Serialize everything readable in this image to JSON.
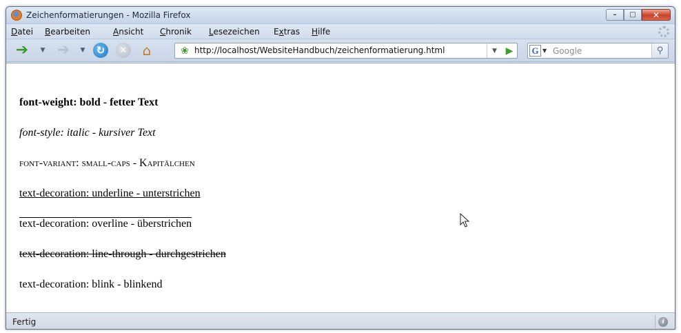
{
  "window": {
    "title": "Zeichenformatierungen - Mozilla Firefox"
  },
  "menubar": {
    "items": [
      {
        "underline": "D",
        "rest": "atei"
      },
      {
        "underline": "B",
        "rest": "earbeiten"
      },
      {
        "underline": "A",
        "rest": "nsicht"
      },
      {
        "underline": "C",
        "rest": "hronik"
      },
      {
        "underline": "L",
        "rest": "esezeichen"
      },
      {
        "prefix": "E",
        "underline": "x",
        "rest": "tras"
      },
      {
        "underline": "H",
        "rest": "ilfe"
      }
    ]
  },
  "navbar": {
    "url": "http://localhost/WebsiteHandbuch/zeichenformatierung.html",
    "search_placeholder": "Google"
  },
  "content": {
    "lines": [
      "font-weight: bold - fetter Text",
      "font-style: italic - kursiver Text",
      "font-variant: small-caps - Kapitälchen",
      "text-decoration: underline - unterstrichen",
      "text-decoration: overline - überstrichen",
      "text-decoration: line-through - durchgestrichen",
      "text-decoration: blink - blinkend"
    ]
  },
  "statusbar": {
    "text": "Fertig"
  },
  "icons": {
    "app": "firefox-icon",
    "back": "back-arrow-icon",
    "forward": "forward-arrow-icon",
    "reload": "reload-icon",
    "stop": "stop-icon",
    "home": "home-icon",
    "site": "site-identity-icon",
    "go": "go-arrow-icon",
    "search_engine": "google-engine-icon",
    "search": "magnifier-icon",
    "throbber": "throbber-icon",
    "status": "status-info-icon"
  }
}
